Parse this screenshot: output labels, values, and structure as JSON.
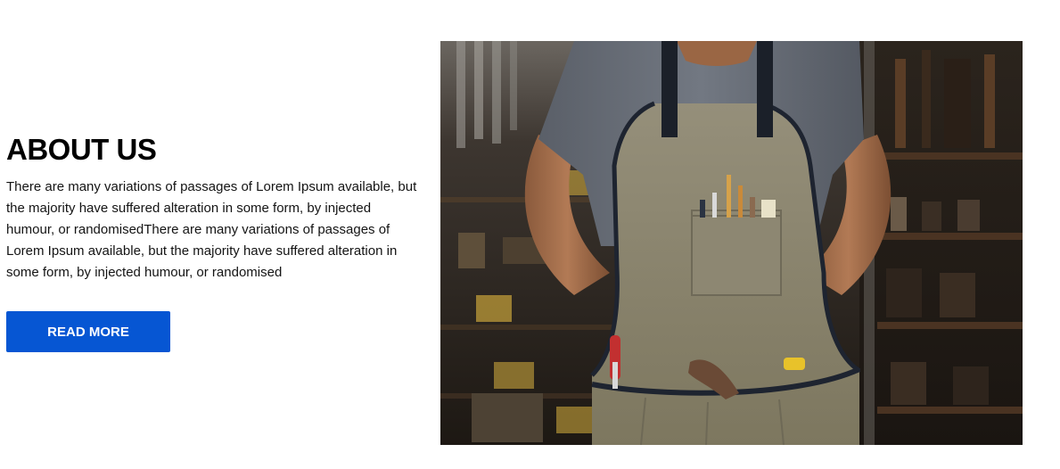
{
  "about": {
    "title": "ABOUT US",
    "body": "There are many variations of passages of Lorem Ipsum available, but the majority have suffered alteration in some form, by injected humour, or randomisedThere are many variations of passages of Lorem Ipsum available, but the majority have suffered alteration in some form, by injected humour, or randomised",
    "button_label": "READ MORE"
  },
  "colors": {
    "accent": "#0656d3",
    "heading": "#000000",
    "text": "#141414"
  },
  "image": {
    "subject": "craftsman-in-apron-photo"
  }
}
